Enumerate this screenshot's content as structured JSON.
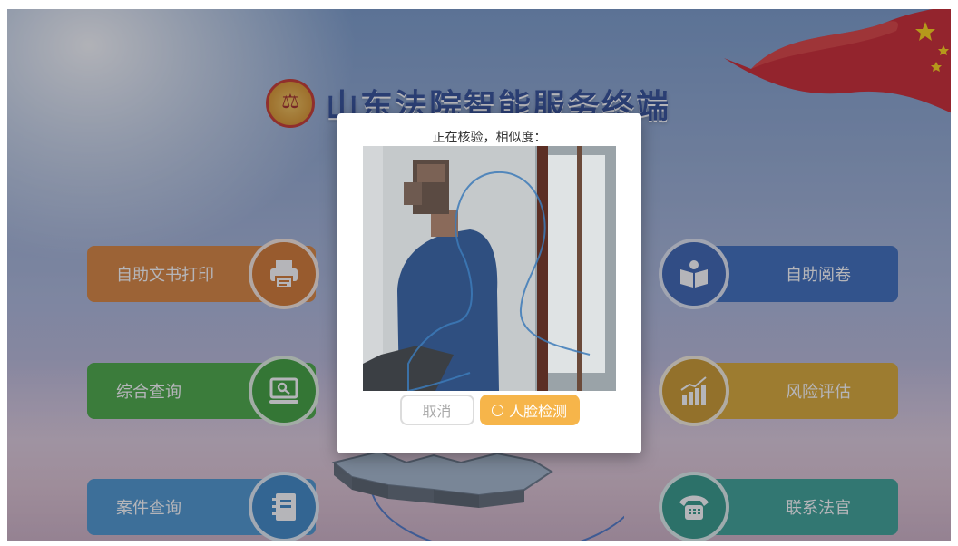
{
  "app": {
    "title": "山东法院智能服务终端"
  },
  "menu": {
    "left": [
      {
        "label": "自助文书打印",
        "icon": "printer-icon",
        "color": "#d77b2c"
      },
      {
        "label": "综合查询",
        "icon": "monitor-search-icon",
        "color": "#3aa335"
      },
      {
        "label": "案件查询",
        "icon": "notebook-icon",
        "color": "#3e8fcb"
      }
    ],
    "right": [
      {
        "label": "自助阅卷",
        "icon": "reader-icon",
        "color": "#2d62b6"
      },
      {
        "label": "风险评估",
        "icon": "rising-chart-icon",
        "color": "#d8a323"
      },
      {
        "label": "联系法官",
        "icon": "telephone-icon",
        "color": "#2c9c8d"
      }
    ]
  },
  "dialog": {
    "message": "正在核验，相似度：",
    "cancel_label": "取消",
    "detect_label": "人脸检测",
    "accent": "#f6b54a"
  }
}
